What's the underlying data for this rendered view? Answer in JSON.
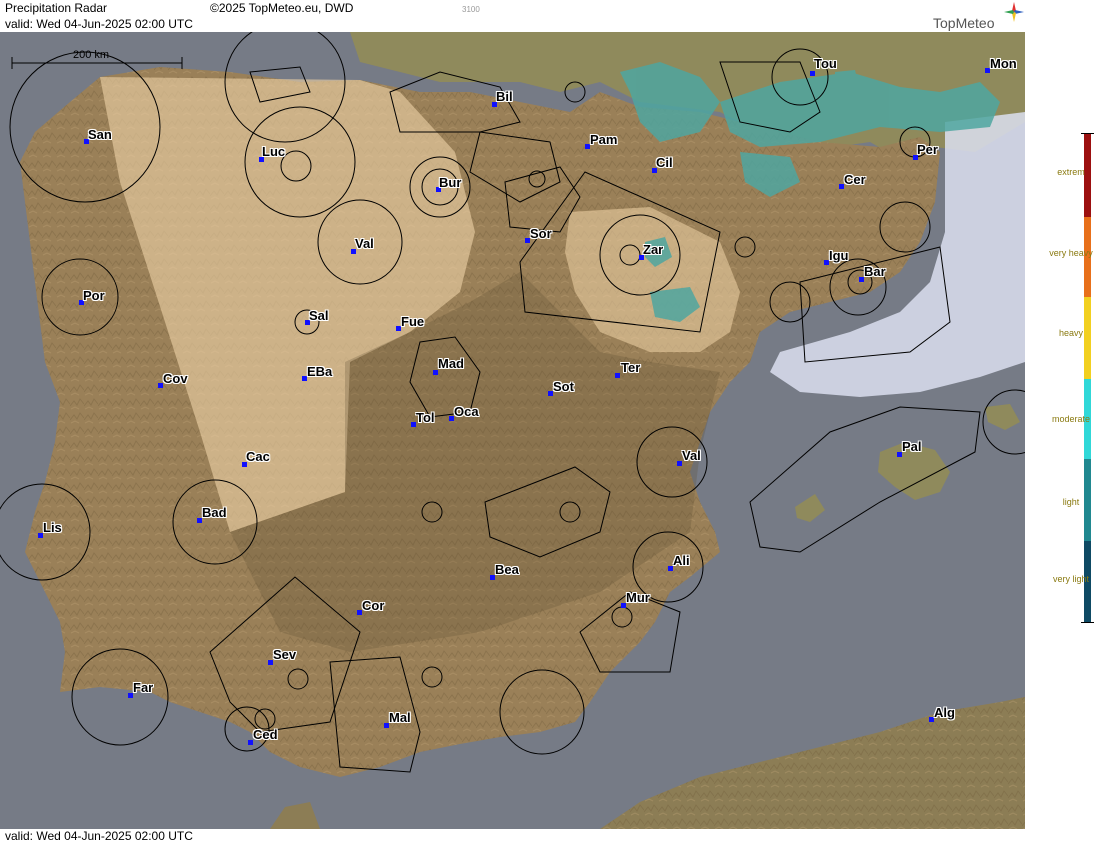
{
  "header": {
    "title": "Precipitation Radar",
    "valid_top": "valid:  Wed  04-Jun-2025 02:00 UTC",
    "copyright": "©2025 TopMeteo.eu, DWD",
    "code": "3100",
    "logo_text": "TopMeteo"
  },
  "footer": {
    "valid_bottom": "valid:  Wed  04-Jun-2025 02:00 UTC"
  },
  "scale_bar": {
    "label": "200 km"
  },
  "legend": {
    "items": [
      {
        "label": "extrem",
        "color": "#9c1010"
      },
      {
        "label": "very heavy",
        "color": "#e8701a"
      },
      {
        "label": "heavy",
        "color": "#f2d020"
      },
      {
        "label": "moderate",
        "color": "#30d8d8"
      },
      {
        "label": "light",
        "color": "#208890"
      },
      {
        "label": "very light",
        "color": "#0e4a64"
      }
    ]
  },
  "colors": {
    "sea": "#767b86",
    "land": "#9a8058",
    "coverage_shade": "#f0d4a8",
    "radar_echo": "#4fa6a0",
    "out_of_range": "#dcdff0",
    "station_dot": "#1010ff"
  },
  "cities": [
    {
      "label": "San"
    },
    {
      "label": "Luc"
    },
    {
      "label": "Bur"
    },
    {
      "label": "Bil"
    },
    {
      "label": "Pam"
    },
    {
      "label": "Tou"
    },
    {
      "label": "Mon"
    },
    {
      "label": "Per"
    },
    {
      "label": "Cil"
    },
    {
      "label": "Cer"
    },
    {
      "label": "Sor"
    },
    {
      "label": "Zar"
    },
    {
      "label": "Igu"
    },
    {
      "label": "Bar"
    },
    {
      "label": "Val"
    },
    {
      "label": "Por"
    },
    {
      "label": "Sal"
    },
    {
      "label": "Fue"
    },
    {
      "label": "Cov"
    },
    {
      "label": "EBa"
    },
    {
      "label": "Mad"
    },
    {
      "label": "Ter"
    },
    {
      "label": "Sot"
    },
    {
      "label": "Tol"
    },
    {
      "label": "Oca"
    },
    {
      "label": "Pal"
    },
    {
      "label": "Val"
    },
    {
      "label": "Cac"
    },
    {
      "label": "Bad"
    },
    {
      "label": "Lis"
    },
    {
      "label": "Ali"
    },
    {
      "label": "Bea"
    },
    {
      "label": "Cor"
    },
    {
      "label": "Mur"
    },
    {
      "label": "Sev"
    },
    {
      "label": "Far"
    },
    {
      "label": "Mal"
    },
    {
      "label": "Ced"
    },
    {
      "label": "Alg"
    }
  ]
}
